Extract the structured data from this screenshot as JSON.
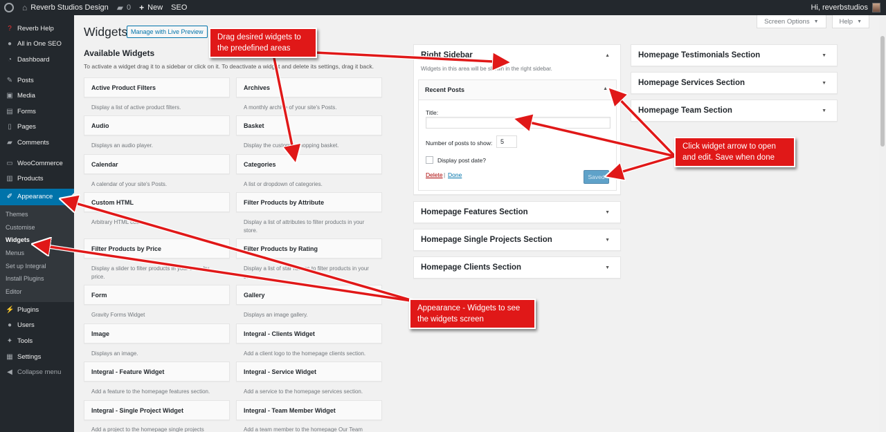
{
  "adminbar": {
    "site_name": "Reverb Studios Design",
    "comments_count": "0",
    "new_label": "New",
    "seo_label": "SEO",
    "greeting": "Hi, reverbstudios"
  },
  "sidebar": {
    "items": [
      {
        "label": "Reverb Help",
        "icon": "question-icon"
      },
      {
        "label": "All in One SEO",
        "icon": "seo-icon"
      },
      {
        "label": "Dashboard",
        "icon": "dashboard-icon"
      },
      {
        "label": "Posts",
        "icon": "pin-icon"
      },
      {
        "label": "Media",
        "icon": "media-icon"
      },
      {
        "label": "Forms",
        "icon": "forms-icon"
      },
      {
        "label": "Pages",
        "icon": "pages-icon"
      },
      {
        "label": "Comments",
        "icon": "comment-icon"
      },
      {
        "label": "WooCommerce",
        "icon": "woo-icon"
      },
      {
        "label": "Products",
        "icon": "products-icon"
      },
      {
        "label": "Appearance",
        "icon": "brush-icon"
      }
    ],
    "submenu": [
      "Themes",
      "Customise",
      "Widgets",
      "Menus",
      "Set up Integral",
      "Install Plugins",
      "Editor"
    ],
    "lower_items": [
      {
        "label": "Plugins",
        "icon": "plugin-icon"
      },
      {
        "label": "Users",
        "icon": "users-icon"
      },
      {
        "label": "Tools",
        "icon": "tools-icon"
      },
      {
        "label": "Settings",
        "icon": "settings-icon"
      },
      {
        "label": "Collapse menu",
        "icon": "collapse-icon"
      }
    ]
  },
  "screen_meta": {
    "screen_options": "Screen Options",
    "help": "Help"
  },
  "header": {
    "title": "Widgets",
    "live_preview": "Manage with Live Preview"
  },
  "available": {
    "title": "Available Widgets",
    "description": "To activate a widget drag it to a sidebar or click on it. To deactivate a widget and delete its settings, drag it back.",
    "widgets": [
      {
        "name": "Active Product Filters",
        "desc": "Display a list of active product filters."
      },
      {
        "name": "Archives",
        "desc": "A monthly archive of your site's Posts."
      },
      {
        "name": "Audio",
        "desc": "Displays an audio player."
      },
      {
        "name": "Basket",
        "desc": "Display the customer shopping basket."
      },
      {
        "name": "Calendar",
        "desc": "A calendar of your site's Posts."
      },
      {
        "name": "Categories",
        "desc": "A list or dropdown of categories."
      },
      {
        "name": "Custom HTML",
        "desc": "Arbitrary HTML code."
      },
      {
        "name": "Filter Products by Attribute",
        "desc": "Display a list of attributes to filter products in your store."
      },
      {
        "name": "Filter Products by Price",
        "desc": "Display a slider to filter products in your store by price."
      },
      {
        "name": "Filter Products by Rating",
        "desc": "Display a list of star ratings to filter products in your store."
      },
      {
        "name": "Form",
        "desc": "Gravity Forms Widget"
      },
      {
        "name": "Gallery",
        "desc": "Displays an image gallery."
      },
      {
        "name": "Image",
        "desc": "Displays an image."
      },
      {
        "name": "Integral - Clients Widget",
        "desc": "Add a client logo to the homepage clients section."
      },
      {
        "name": "Integral - Feature Widget",
        "desc": "Add a feature to the homepage features section."
      },
      {
        "name": "Integral - Service Widget",
        "desc": "Add a service to the homepage services section."
      },
      {
        "name": "Integral - Single Project Widget",
        "desc": "Add a project to the homepage single projects"
      },
      {
        "name": "Integral - Team Member Widget",
        "desc": "Add a team member to the homepage Our Team"
      }
    ]
  },
  "right_sidebar": {
    "title": "Right Sidebar",
    "description": "Widgets in this area will be shown in the right sidebar.",
    "recent_posts": {
      "title": "Recent Posts",
      "title_label": "Title:",
      "title_value": "",
      "num_label": "Number of posts to show:",
      "num_value": "5",
      "date_label": "Display post date?",
      "delete_label": "Delete",
      "separator": "|",
      "done_label": "Done",
      "saved_label": "Saved"
    }
  },
  "areas_mid": [
    "Homepage Features Section",
    "Homepage Single Projects Section",
    "Homepage Clients Section"
  ],
  "areas_right": [
    "Homepage Testimonials Section",
    "Homepage Services Section",
    "Homepage Team Section"
  ],
  "callouts": {
    "drag": "Drag desired widgets to the predefined areas",
    "arrow": "Click widget arrow to open and edit. Save when done",
    "appearance": "Appearance - Widgets to see the widgets screen"
  },
  "colors": {
    "callout": "#e01818",
    "active_menu": "#0073aa",
    "adminbar": "#23282d"
  }
}
